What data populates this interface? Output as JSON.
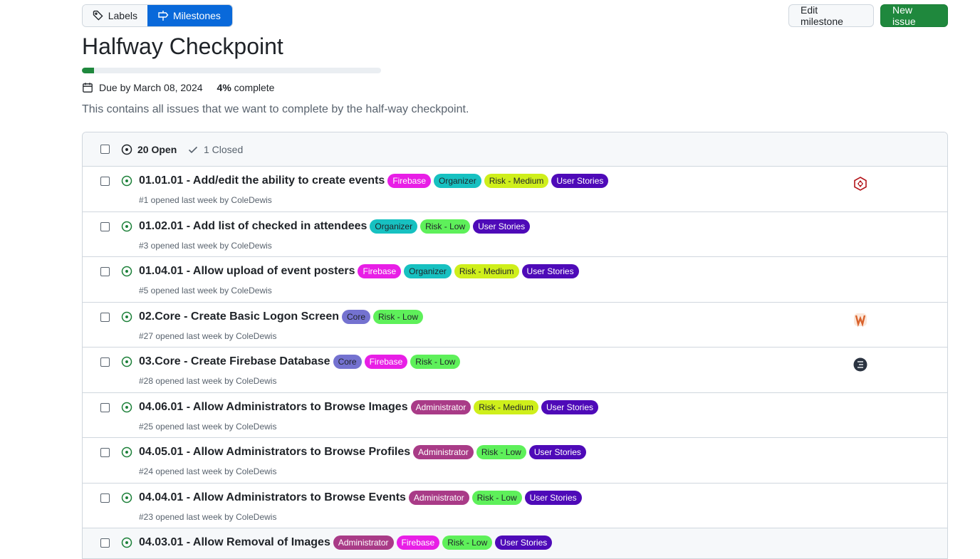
{
  "header": {
    "labels_tab": "Labels",
    "milestones_tab": "Milestones",
    "edit_button": "Edit milestone",
    "new_issue_button": "New issue"
  },
  "milestone": {
    "title": "Halfway Checkpoint",
    "progress_percent": 4,
    "due": "Due by March 08, 2024",
    "complete_value": "4%",
    "complete_text": "complete",
    "description": "This contains all issues that we want to complete by the half-way checkpoint."
  },
  "list": {
    "open_count": "20 Open",
    "closed_count": "1 Closed"
  },
  "colors": {
    "Firebase": {
      "bg": "#e81ee6",
      "fg": "#ffffff"
    },
    "Organizer": {
      "bg": "#17c1c1",
      "fg": "#1f2328"
    },
    "Risk - Medium": {
      "bg": "#cfef1b",
      "fg": "#1f2328"
    },
    "Risk - Low": {
      "bg": "#5ef05a",
      "fg": "#1f2328"
    },
    "User Stories": {
      "bg": "#4e0ab8",
      "fg": "#ffffff"
    },
    "Core": {
      "bg": "#7472d0",
      "fg": "#1f2328"
    },
    "Administrator": {
      "bg": "#a93b87",
      "fg": "#ffffff"
    }
  },
  "issues": [
    {
      "title": "01.01.01 - Add/edit the ability to create events",
      "labels": [
        "Firebase",
        "Organizer",
        "Risk - Medium",
        "User Stories"
      ],
      "meta": "#1 opened last week by ColeDewis",
      "avatar": "hexagon-avatar"
    },
    {
      "title": "01.02.01 - Add list of checked in attendees",
      "labels": [
        "Organizer",
        "Risk - Low",
        "User Stories"
      ],
      "meta": "#3 opened last week by ColeDewis",
      "avatar": ""
    },
    {
      "title": "01.04.01 - Allow upload of event posters",
      "labels": [
        "Firebase",
        "Organizer",
        "Risk - Medium",
        "User Stories"
      ],
      "meta": "#5 opened last week by ColeDewis",
      "avatar": ""
    },
    {
      "title": "02.Core - Create Basic Logon Screen",
      "labels": [
        "Core",
        "Risk - Low"
      ],
      "meta": "#27 opened last week by ColeDewis",
      "avatar": "orange-avatar"
    },
    {
      "title": "03.Core - Create Firebase Database",
      "labels": [
        "Core",
        "Firebase",
        "Risk - Low"
      ],
      "meta": "#28 opened last week by ColeDewis",
      "avatar": "dark-avatar"
    },
    {
      "title": "04.06.01 - Allow Administrators to Browse Images",
      "labels": [
        "Administrator",
        "Risk - Medium",
        "User Stories"
      ],
      "meta": "#25 opened last week by ColeDewis",
      "avatar": ""
    },
    {
      "title": "04.05.01 - Allow Administrators to Browse Profiles",
      "labels": [
        "Administrator",
        "Risk - Low",
        "User Stories"
      ],
      "meta": "#24 opened last week by ColeDewis",
      "avatar": ""
    },
    {
      "title": "04.04.01 - Allow Administrators to Browse Events",
      "labels": [
        "Administrator",
        "Risk - Low",
        "User Stories"
      ],
      "meta": "#23 opened last week by ColeDewis",
      "avatar": ""
    },
    {
      "title": "04.03.01 - Allow Removal of Images",
      "labels": [
        "Administrator",
        "Firebase",
        "Risk - Low",
        "User Stories"
      ],
      "meta": "",
      "avatar": ""
    }
  ]
}
